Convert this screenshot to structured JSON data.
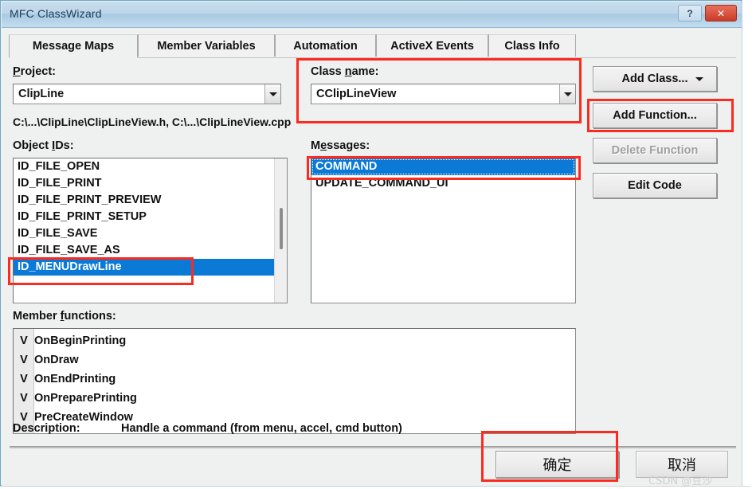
{
  "window": {
    "title": "MFC ClassWizard",
    "help_button": "?",
    "close_button": "✕"
  },
  "tabs": [
    {
      "label": "Message Maps",
      "active": true
    },
    {
      "label": "Member Variables",
      "active": false
    },
    {
      "label": "Automation",
      "active": false
    },
    {
      "label": "ActiveX Events",
      "active": false
    },
    {
      "label": "Class Info",
      "active": false
    }
  ],
  "project": {
    "label": "Project:",
    "value": "ClipLine"
  },
  "class_name": {
    "label": "Class name:",
    "value": "CClipLineView"
  },
  "file_path": "C:\\...\\ClipLine\\ClipLineView.h, C:\\...\\ClipLineView.cpp",
  "object_ids": {
    "label": "Object IDs:",
    "items": [
      {
        "id": "ID_FILE_OPEN",
        "selected": false
      },
      {
        "id": "ID_FILE_PRINT",
        "selected": false
      },
      {
        "id": "ID_FILE_PRINT_PREVIEW",
        "selected": false
      },
      {
        "id": "ID_FILE_PRINT_SETUP",
        "selected": false
      },
      {
        "id": "ID_FILE_SAVE",
        "selected": false
      },
      {
        "id": "ID_FILE_SAVE_AS",
        "selected": false
      },
      {
        "id": "ID_MENUDrawLine",
        "selected": true
      }
    ]
  },
  "messages": {
    "label": "Messages:",
    "items": [
      {
        "name": "COMMAND",
        "selected": true
      },
      {
        "name": "UPDATE_COMMAND_UI",
        "selected": false
      }
    ]
  },
  "member_functions": {
    "label": "Member functions:",
    "items": [
      {
        "marker": "V",
        "name": "OnBeginPrinting"
      },
      {
        "marker": "V",
        "name": "OnDraw"
      },
      {
        "marker": "V",
        "name": "OnEndPrinting"
      },
      {
        "marker": "V",
        "name": "OnPreparePrinting"
      },
      {
        "marker": "V",
        "name": "PreCreateWindow"
      }
    ]
  },
  "description": {
    "label": "Description:",
    "text": "Handle a command (from menu, accel, cmd button)"
  },
  "side_buttons": [
    {
      "label": "Add Class...",
      "dropdown": true,
      "disabled": false
    },
    {
      "label": "Add Function...",
      "dropdown": false,
      "disabled": false
    },
    {
      "label": "Delete Function",
      "dropdown": false,
      "disabled": true
    },
    {
      "label": "Edit Code",
      "dropdown": false,
      "disabled": false
    }
  ],
  "footer_buttons": {
    "ok": "确定",
    "cancel": "取消"
  },
  "watermark": "CSDN @豆沙",
  "colors": {
    "selection_blue": "#0a7ad6",
    "annotation_red": "#fb2b20",
    "dialog_face": "#eff0f0",
    "title_blue": "#bdd6e9"
  }
}
